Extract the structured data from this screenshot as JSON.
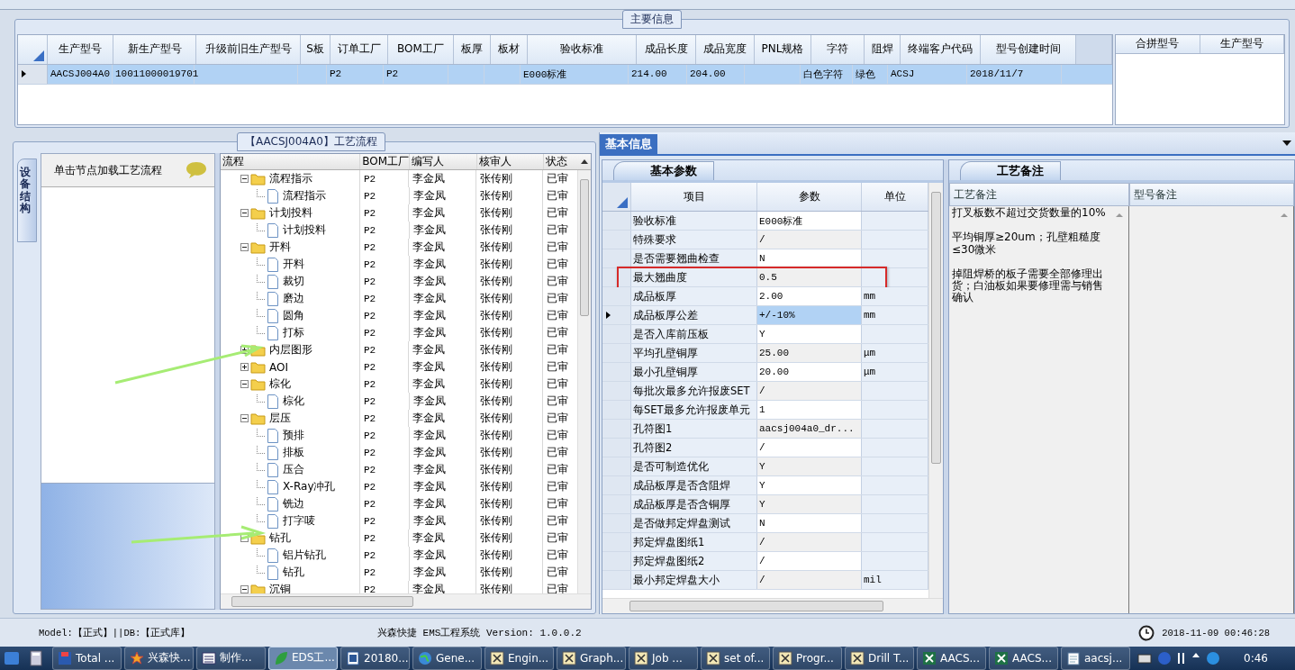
{
  "main_info": {
    "title": "主要信息",
    "columns": [
      "生产型号",
      "新生产型号",
      "升级前旧生产型号",
      "S板",
      "订单工厂",
      "BOM工厂",
      "板厚",
      "板材",
      "验收标准",
      "成品长度",
      "成品宽度",
      "PNL规格",
      "字符",
      "阻焊",
      "终端客户代码",
      "型号创建时间"
    ],
    "rows": [
      {
        "selected": true,
        "cells": [
          "AACSJ004A0",
          "10011000019701",
          null,
          null,
          "P2",
          "P2",
          null,
          null,
          "E000标准",
          "214.00",
          "204.00",
          null,
          "白色字符",
          "绿色",
          "ACSJ",
          "2018/11/7"
        ]
      }
    ],
    "merge_columns": [
      "合拼型号",
      "生产型号"
    ]
  },
  "process": {
    "title": "【AACSJ004A0】工艺流程",
    "side_tab": "设备结构",
    "list_header": "单击节点加载工艺流程",
    "columns": [
      "流程",
      "BOM工厂",
      "编写人",
      "核审人",
      "状态"
    ],
    "tree": [
      {
        "name": "流程指示",
        "kind": "folder",
        "expanded": true,
        "bom": "P2",
        "author": "李金凤",
        "reviewer": "张传刚",
        "status": "已审",
        "children": [
          {
            "name": "流程指示",
            "kind": "step",
            "bom": "P2",
            "author": "李金凤",
            "reviewer": "张传刚",
            "status": "已审"
          }
        ]
      },
      {
        "name": "计划投料",
        "kind": "folder",
        "expanded": true,
        "bom": "P2",
        "author": "李金凤",
        "reviewer": "张传刚",
        "status": "已审",
        "children": [
          {
            "name": "计划投料",
            "kind": "step",
            "bom": "P2",
            "author": "李金凤",
            "reviewer": "张传刚",
            "status": "已审"
          }
        ]
      },
      {
        "name": "开料",
        "kind": "folder",
        "expanded": true,
        "bom": "P2",
        "author": "李金凤",
        "reviewer": "张传刚",
        "status": "已审",
        "children": [
          {
            "name": "开料",
            "kind": "step",
            "bom": "P2",
            "author": "李金凤",
            "reviewer": "张传刚",
            "status": "已审"
          },
          {
            "name": "裁切",
            "kind": "step",
            "bom": "P2",
            "author": "李金凤",
            "reviewer": "张传刚",
            "status": "已审"
          },
          {
            "name": "磨边",
            "kind": "step",
            "bom": "P2",
            "author": "李金凤",
            "reviewer": "张传刚",
            "status": "已审"
          },
          {
            "name": "圆角",
            "kind": "step",
            "bom": "P2",
            "author": "李金凤",
            "reviewer": "张传刚",
            "status": "已审"
          },
          {
            "name": "打标",
            "kind": "step",
            "bom": "P2",
            "author": "李金凤",
            "reviewer": "张传刚",
            "status": "已审"
          }
        ]
      },
      {
        "name": "内层图形",
        "kind": "folder",
        "expanded": false,
        "bom": "P2",
        "author": "李金凤",
        "reviewer": "张传刚",
        "status": "已审"
      },
      {
        "name": "AOI",
        "kind": "folder",
        "expanded": false,
        "bom": "P2",
        "author": "李金凤",
        "reviewer": "张传刚",
        "status": "已审"
      },
      {
        "name": "棕化",
        "kind": "folder",
        "expanded": true,
        "bom": "P2",
        "author": "李金凤",
        "reviewer": "张传刚",
        "status": "已审",
        "children": [
          {
            "name": "棕化",
            "kind": "step",
            "bom": "P2",
            "author": "李金凤",
            "reviewer": "张传刚",
            "status": "已审"
          }
        ]
      },
      {
        "name": "层压",
        "kind": "folder",
        "expanded": true,
        "bom": "P2",
        "author": "李金凤",
        "reviewer": "张传刚",
        "status": "已审",
        "children": [
          {
            "name": "预排",
            "kind": "step",
            "bom": "P2",
            "author": "李金凤",
            "reviewer": "张传刚",
            "status": "已审"
          },
          {
            "name": "排板",
            "kind": "step",
            "bom": "P2",
            "author": "李金凤",
            "reviewer": "张传刚",
            "status": "已审"
          },
          {
            "name": "压合",
            "kind": "step",
            "bom": "P2",
            "author": "李金凤",
            "reviewer": "张传刚",
            "status": "已审"
          },
          {
            "name": "X-Ray冲孔",
            "kind": "step",
            "bom": "P2",
            "author": "李金凤",
            "reviewer": "张传刚",
            "status": "已审"
          },
          {
            "name": "铣边",
            "kind": "step",
            "bom": "P2",
            "author": "李金凤",
            "reviewer": "张传刚",
            "status": "已审"
          },
          {
            "name": "打字唛",
            "kind": "step",
            "bom": "P2",
            "author": "李金凤",
            "reviewer": "张传刚",
            "status": "已审"
          }
        ]
      },
      {
        "name": "钻孔",
        "kind": "folder",
        "expanded": true,
        "bom": "P2",
        "author": "李金凤",
        "reviewer": "张传刚",
        "status": "已审",
        "children": [
          {
            "name": "铝片钻孔",
            "kind": "step",
            "bom": "P2",
            "author": "李金凤",
            "reviewer": "张传刚",
            "status": "已审"
          },
          {
            "name": "钻孔",
            "kind": "step",
            "bom": "P2",
            "author": "李金凤",
            "reviewer": "张传刚",
            "status": "已审"
          }
        ]
      },
      {
        "name": "沉铜",
        "kind": "folder",
        "expanded": true,
        "bom": "P2",
        "author": "李金凤",
        "reviewer": "张传刚",
        "status": "已审"
      }
    ]
  },
  "info_tabs": [
    {
      "label": "基本信息",
      "selected": true
    }
  ],
  "params": {
    "tabs": [
      {
        "label": "基本参数",
        "selected": true
      }
    ],
    "columns": [
      "项目",
      "参数",
      "单位"
    ],
    "rows": [
      {
        "item": "验收标准",
        "value": "E000标准",
        "selected": false,
        "marked": false
      },
      {
        "item": "特殊要求",
        "value": "/",
        "selected": false,
        "marked": false
      },
      {
        "item": "是否需要翘曲检查",
        "value": "N",
        "selected": false,
        "marked": false
      },
      {
        "item": "最大翘曲度",
        "value": "0.5",
        "selected": false,
        "marked": true
      },
      {
        "item": "成品板厚",
        "value": "2.00",
        "unit": "mm",
        "selected": false,
        "marked": false
      },
      {
        "item": "成品板厚公差",
        "value": "+/-10%",
        "unit": "mm",
        "selected": true,
        "marked": false
      },
      {
        "item": "是否入库前压板",
        "value": "Y",
        "selected": false,
        "marked": false
      },
      {
        "item": "平均孔壁铜厚",
        "value": "25.00",
        "unit": "μm",
        "selected": false,
        "marked": false
      },
      {
        "item": "最小孔壁铜厚",
        "value": "20.00",
        "unit": "μm",
        "selected": false,
        "marked": false
      },
      {
        "item": "每批次最多允许报废SET",
        "value": "/",
        "selected": false,
        "marked": false
      },
      {
        "item": "每SET最多允许报废单元",
        "value": "1",
        "selected": false,
        "marked": false
      },
      {
        "item": "孔符图1",
        "value": "aacsj004a0_dr...",
        "selected": false,
        "marked": false
      },
      {
        "item": "孔符图2",
        "value": "/",
        "selected": false,
        "marked": false
      },
      {
        "item": "是否可制造优化",
        "value": "Y",
        "selected": false,
        "marked": false
      },
      {
        "item": "成品板厚是否含阻焊",
        "value": "Y",
        "selected": false,
        "marked": false
      },
      {
        "item": "成品板厚是否含铜厚",
        "value": "Y",
        "selected": false,
        "marked": false
      },
      {
        "item": "是否做邦定焊盘测试",
        "value": "N",
        "selected": false,
        "marked": false
      },
      {
        "item": "邦定焊盘图纸1",
        "value": "/",
        "selected": false,
        "marked": false
      },
      {
        "item": "邦定焊盘图纸2",
        "value": "/",
        "selected": false,
        "marked": false
      },
      {
        "item": "最小邦定焊盘大小",
        "value": "/",
        "unit": "mil",
        "selected": false,
        "marked": false
      }
    ]
  },
  "notes": {
    "tabs": [
      {
        "label": "工艺备注",
        "selected": true
      }
    ],
    "columns": [
      "工艺备注",
      "型号备注"
    ],
    "process_notes": [
      "打叉板数不超过交货数量的10%",
      "平均铜厚≥20um；孔壁粗糙度≤30微米",
      "掉阻焊桥的板子需要全部修理出货；白油板如果要修理需与销售确认"
    ]
  },
  "status_bar": {
    "left": "Model:【正式】||DB:【正式库】",
    "center": "兴森快捷 EMS工程系统 Version: 1.0.0.2",
    "time": "2018-11-09 00:46:28"
  },
  "taskbar": {
    "items": [
      {
        "label": "Total ...",
        "kind": "disk",
        "selected": false
      },
      {
        "label": "兴森快...",
        "kind": "star",
        "selected": false
      },
      {
        "label": "制作...",
        "kind": "list",
        "selected": false
      },
      {
        "label": "EDS工...",
        "kind": "eds",
        "selected": true
      },
      {
        "label": "20180...",
        "kind": "doc",
        "selected": false
      },
      {
        "label": "Gene...",
        "kind": "globe",
        "selected": false
      },
      {
        "label": "Engin...",
        "kind": "x",
        "selected": false
      },
      {
        "label": "Graph...",
        "kind": "x",
        "selected": false
      },
      {
        "label": "Job ...",
        "kind": "x",
        "selected": false
      },
      {
        "label": "set of...",
        "kind": "x",
        "selected": false
      },
      {
        "label": "Progr...",
        "kind": "x",
        "selected": false
      },
      {
        "label": "Drill T...",
        "kind": "x",
        "selected": false
      },
      {
        "label": "AACS...",
        "kind": "excel",
        "selected": false
      },
      {
        "label": "AACS...",
        "kind": "excel",
        "selected": false
      },
      {
        "label": "aacsj...",
        "kind": "notepad",
        "selected": false
      }
    ],
    "clock": "0:46"
  }
}
